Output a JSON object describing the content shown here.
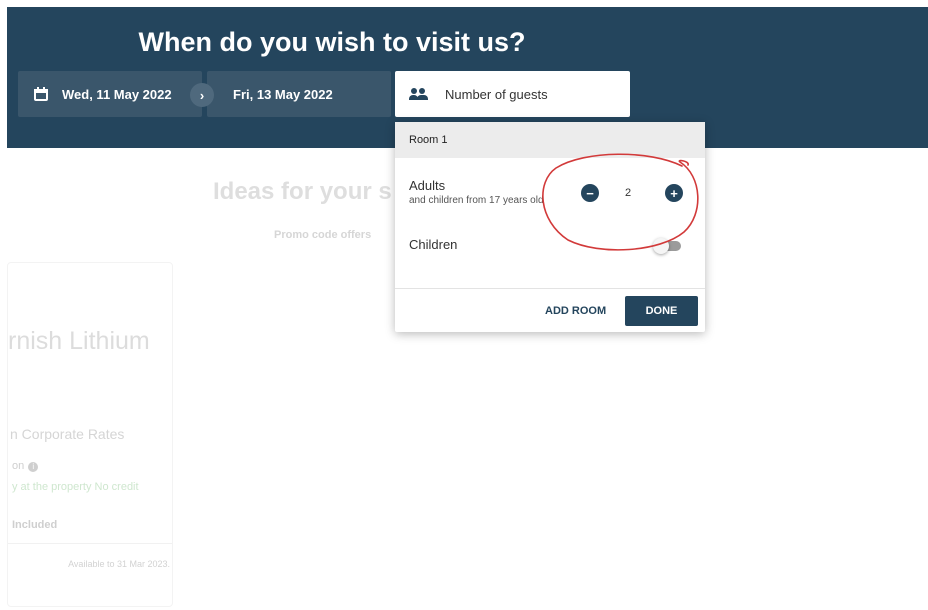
{
  "header": {
    "title": "When do you wish to visit us?",
    "date_from": "Wed, 11 May 2022",
    "date_to": "Fri, 13 May 2022",
    "guests_label": "Number of guests",
    "arrow_glyph": "›"
  },
  "background": {
    "ideas_title": "Ideas for your s",
    "promo_link": "Promo code offers"
  },
  "card": {
    "property_name": "rnish Lithium",
    "rate_name": "n Corporate Rates",
    "cancellation": "on",
    "info_glyph": "i",
    "payment": "y at the property No credit",
    "included": "Included",
    "availability": "Available to 31 Mar 2023."
  },
  "guest_popup": {
    "room_title": "Room 1",
    "adults_label": "Adults",
    "adults_sub": "and children from 17 years old",
    "adults_count": "2",
    "minus_glyph": "−",
    "plus_glyph": "+",
    "children_label": "Children",
    "children_enabled": false,
    "add_room_label": "ADD ROOM",
    "done_label": "DONE"
  },
  "colors": {
    "brand": "#24455d",
    "date_box": "#3a566b",
    "annotation": "#d23a3a"
  }
}
